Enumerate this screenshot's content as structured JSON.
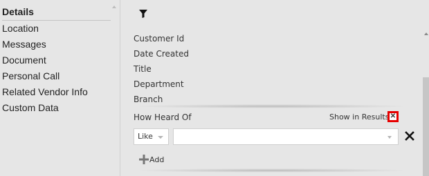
{
  "sidebar": {
    "items": [
      {
        "label": "Details",
        "active": true
      },
      {
        "label": "Location"
      },
      {
        "label": "Messages"
      },
      {
        "label": "Document"
      },
      {
        "label": "Personal Call"
      },
      {
        "label": "Related Vendor Info"
      },
      {
        "label": "Custom Data"
      }
    ]
  },
  "main": {
    "filter_icon": "filter-icon",
    "fields": [
      "Customer Id",
      "Date Created",
      "Title",
      "Department",
      "Branch"
    ],
    "criteria": {
      "field_label": "How Heard Of",
      "show_in_results_label": "Show in Results",
      "show_in_results_checked": true,
      "operator_selected": "Like",
      "value": "",
      "remove_icon": "close-icon"
    },
    "add_label": "Add",
    "colors": {
      "highlight": "#e60000",
      "background": "#e6e6e6"
    }
  }
}
